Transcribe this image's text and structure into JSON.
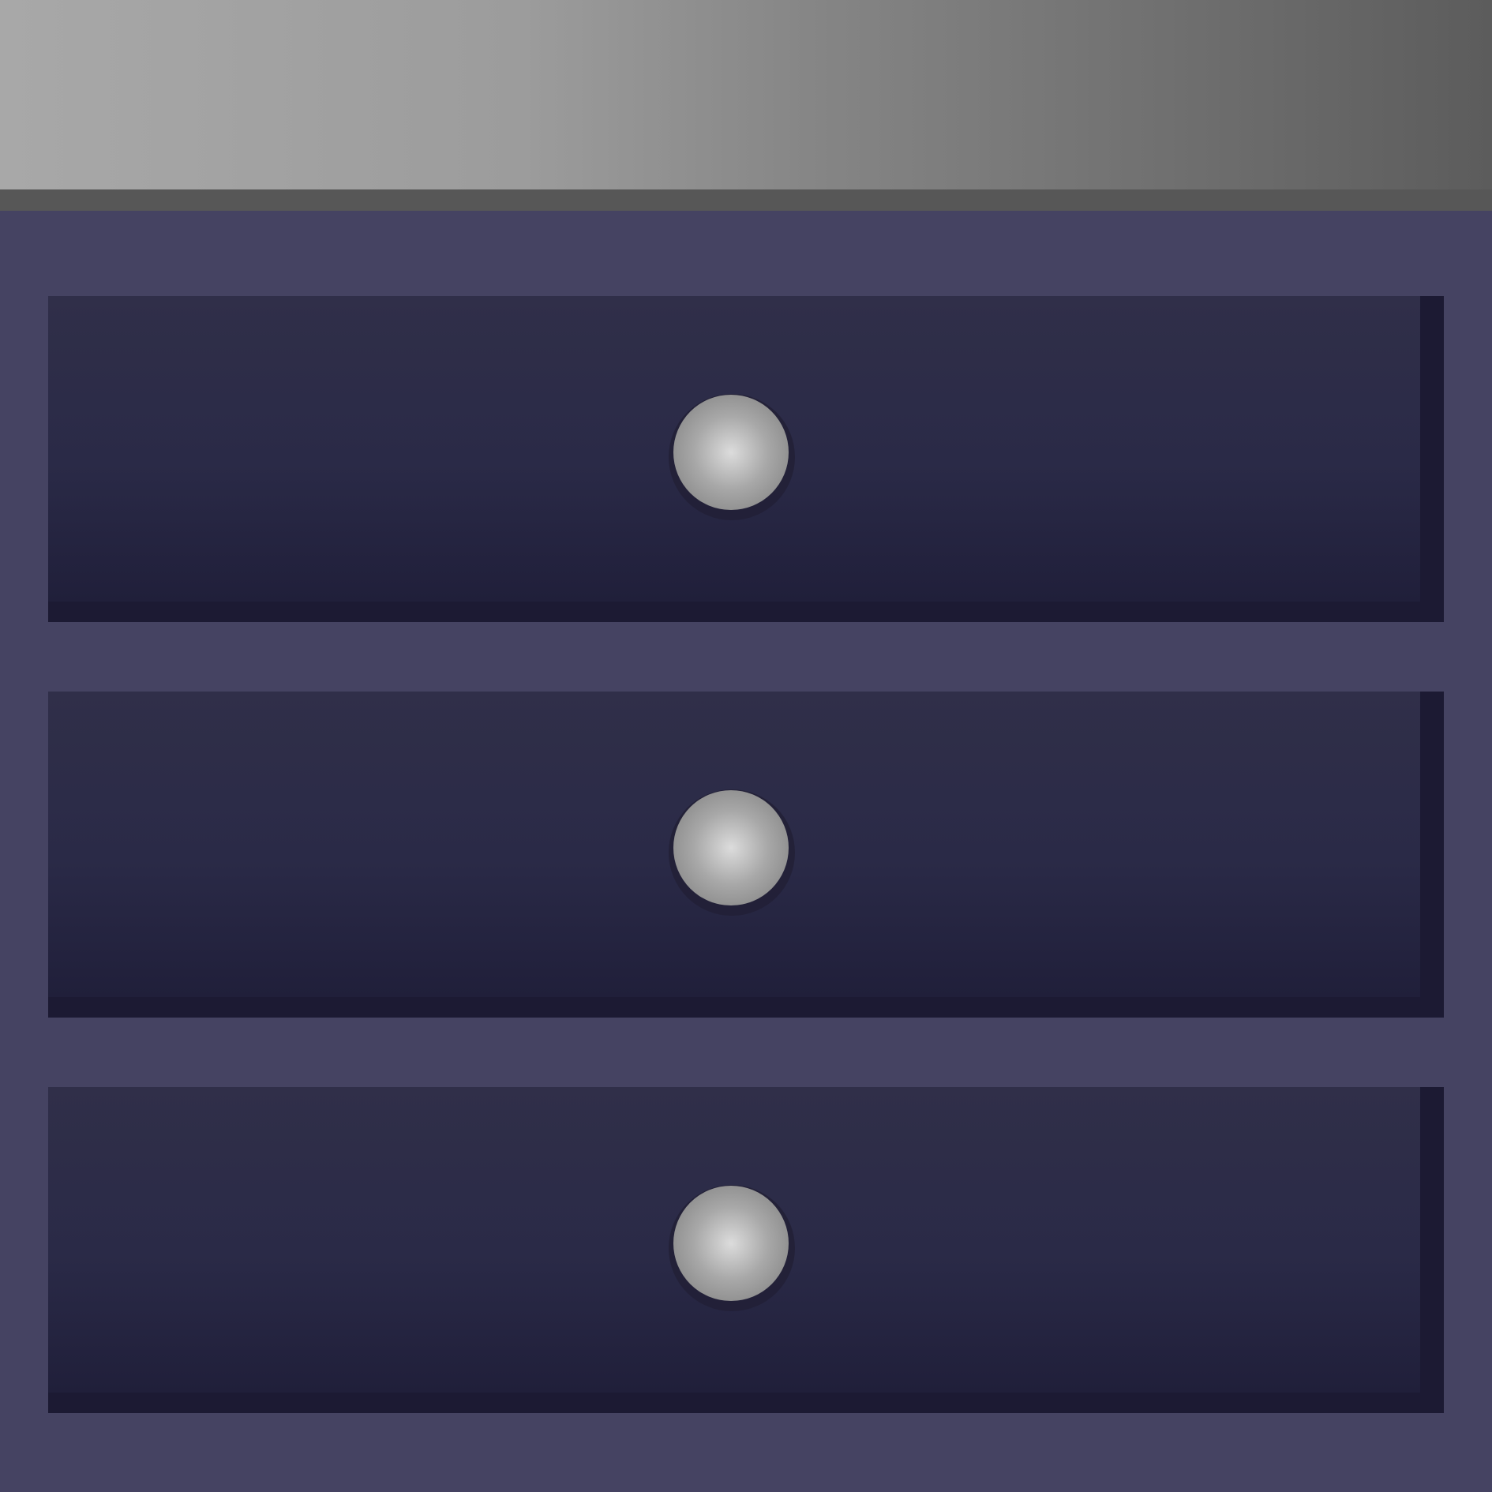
{
  "colors": {
    "top_panel_gradient_start": "#a8a8a8",
    "top_panel_gradient_end": "#5c5c5c",
    "top_ledge": "#575757",
    "cabinet_body": "#454362",
    "drawer_front_top": "#302f49",
    "drawer_front_middle": "#2a2a47",
    "drawer_front_bottom": "#201f3a",
    "drawer_edge": "#1c1a33",
    "knob_highlight": "#dcdcdc",
    "knob_mid": "#a8a8a8",
    "knob_edge": "#7a7a7a",
    "knob_shadow": "#222036"
  },
  "drawers": [
    {
      "knob_icon": "round-knob-icon"
    },
    {
      "knob_icon": "round-knob-icon"
    },
    {
      "knob_icon": "round-knob-icon"
    }
  ]
}
